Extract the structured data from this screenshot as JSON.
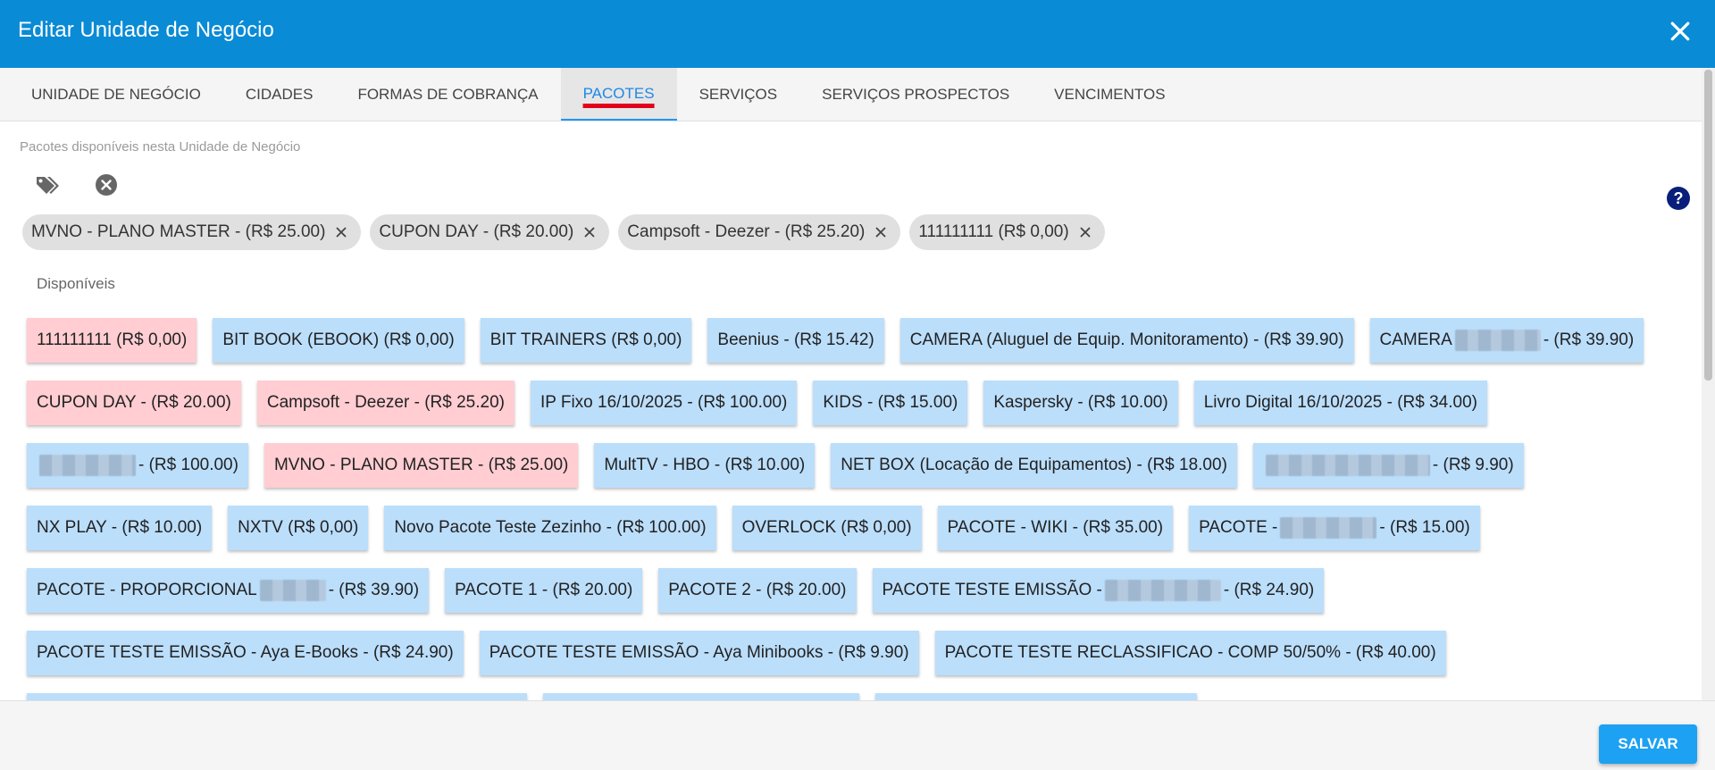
{
  "dialog": {
    "title": "Editar Unidade de Negócio",
    "header_color": "#0a8bd6"
  },
  "tabs": [
    {
      "label": "UNIDADE DE NEGÓCIO",
      "active": false
    },
    {
      "label": "CIDADES",
      "active": false
    },
    {
      "label": "FORMAS DE COBRANÇA",
      "active": false
    },
    {
      "label": "PACOTES",
      "active": true
    },
    {
      "label": "SERVIÇOS",
      "active": false
    },
    {
      "label": "SERVIÇOS PROSPECTOS",
      "active": false
    },
    {
      "label": "VENCIMENTOS",
      "active": false
    }
  ],
  "packages": {
    "hint": "Pacotes disponíveis nesta Unidade de Negócio",
    "selected": [
      {
        "label": "MVNO - PLANO MASTER - (R$ 25.00)"
      },
      {
        "label": "CUPON DAY - (R$ 20.00)"
      },
      {
        "label": "Campsoft - Deezer - (R$ 25.20)"
      },
      {
        "label": "111111111 (R$ 0,00)"
      }
    ],
    "available_label": "Disponíveis",
    "available": [
      {
        "label": "111111111 (R$ 0,00)",
        "selected": true
      },
      {
        "label": "BIT BOOK (EBOOK) (R$ 0,00)",
        "selected": false
      },
      {
        "label": "BIT TRAINERS (R$ 0,00)",
        "selected": false
      },
      {
        "label": "Beenius - (R$ 15.42)",
        "selected": false
      },
      {
        "label": "CAMERA (Aluguel de Equip. Monitoramento) - (R$ 39.90)",
        "selected": false
      },
      {
        "label": "CAMERA",
        "suffix": "- (R$ 39.90)",
        "redacted": 1,
        "selected": false
      },
      {
        "label": "CUPON DAY - (R$ 20.00)",
        "selected": true
      },
      {
        "label": "Campsoft - Deezer - (R$ 25.20)",
        "selected": true
      },
      {
        "label": "IP Fixo 16/10/2025 - (R$ 100.00)",
        "selected": false
      },
      {
        "label": "KIDS - (R$ 15.00)",
        "selected": false
      },
      {
        "label": "Kaspersky - (R$ 10.00)",
        "selected": false
      },
      {
        "label": "Livro Digital 16/10/2025 - (R$ 34.00)",
        "selected": false
      },
      {
        "label": "",
        "suffix": "- (R$ 100.00)",
        "redacted": 2,
        "selected": false
      },
      {
        "label": "MVNO - PLANO MASTER - (R$ 25.00)",
        "selected": true
      },
      {
        "label": "MultTV - HBO - (R$ 10.00)",
        "selected": false
      },
      {
        "label": "NET BOX (Locação de Equipamentos) - (R$ 18.00)",
        "selected": false
      },
      {
        "label": "",
        "suffix": "- (R$ 9.90)",
        "redacted": 3,
        "selected": false
      },
      {
        "label": "NX PLAY - (R$ 10.00)",
        "selected": false
      },
      {
        "label": "NXTV (R$ 0,00)",
        "selected": false
      },
      {
        "label": "Novo Pacote Teste Zezinho - (R$ 100.00)",
        "selected": false
      },
      {
        "label": "OVERLOCK (R$ 0,00)",
        "selected": false
      },
      {
        "label": "PACOTE - WIKI - (R$ 35.00)",
        "selected": false
      },
      {
        "label": "PACOTE -",
        "suffix": "- (R$ 15.00)",
        "redacted": 4,
        "selected": false
      },
      {
        "label": "PACOTE - PROPORCIONAL",
        "suffix": "- (R$ 39.90)",
        "redacted": 5,
        "selected": false
      },
      {
        "label": "PACOTE 1 - (R$ 20.00)",
        "selected": false
      },
      {
        "label": "PACOTE 2 - (R$ 20.00)",
        "selected": false
      },
      {
        "label": "PACOTE TESTE EMISSÃO -",
        "suffix": "- (R$ 24.90)",
        "redacted": 6,
        "selected": false
      },
      {
        "label": "PACOTE TESTE EMISSÃO - Aya E-Books - (R$ 24.90)",
        "selected": false
      },
      {
        "label": "PACOTE TESTE EMISSÃO - Aya Minibooks - (R$ 9.90)",
        "selected": false
      },
      {
        "label": "PACOTE TESTE RECLASSIFICAO - COMP 50/50% - (R$ 40.00)",
        "selected": false
      }
    ]
  },
  "footer": {
    "save_label": "SALVAR"
  },
  "colors": {
    "available_bg": "#bbdefb",
    "selected_bg": "#ffcdd2",
    "chip_bg": "#e0e0e0",
    "save_bg": "#1da1f2"
  },
  "icons": {
    "close": "close-icon",
    "tags": "tags-icon",
    "clear": "clear-circle-icon",
    "help": "help-circle-icon"
  }
}
